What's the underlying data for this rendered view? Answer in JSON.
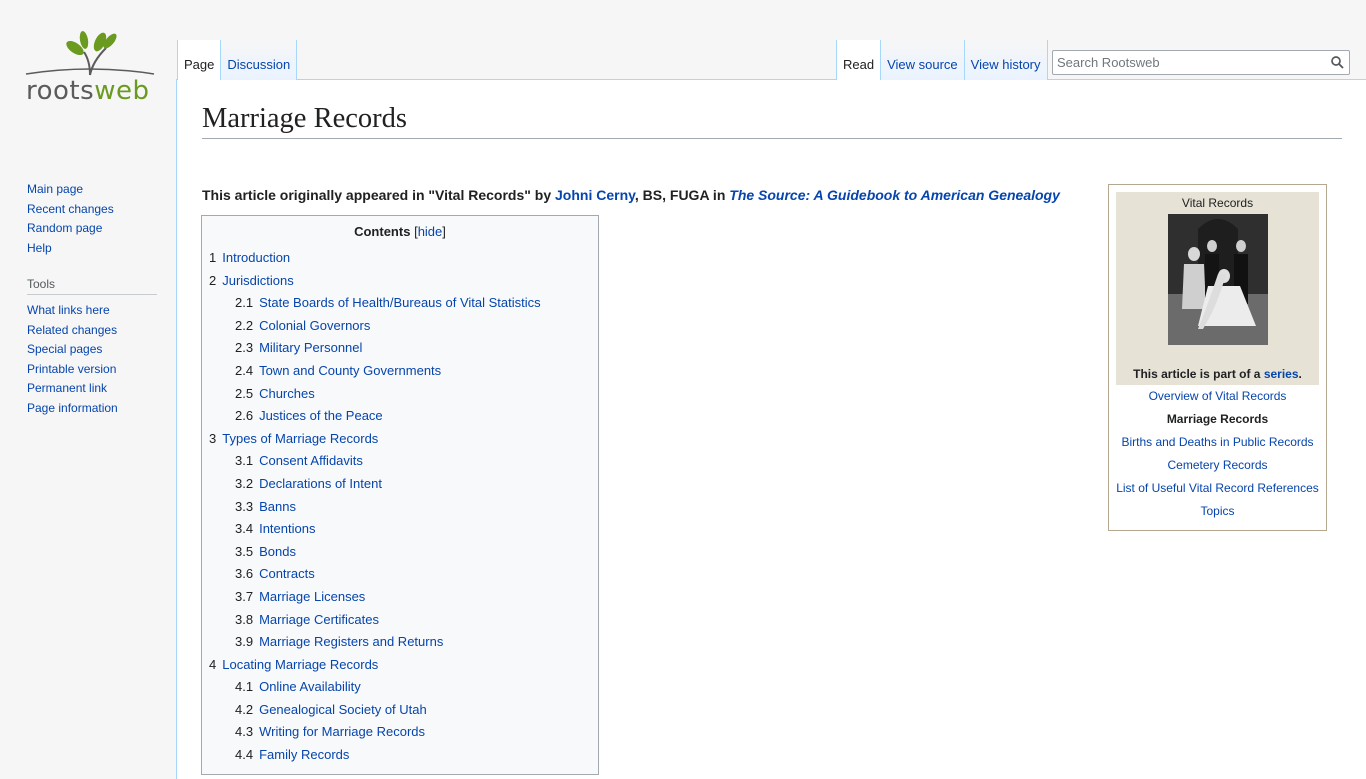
{
  "logo": {
    "text_main": "roots",
    "text_accent": "web"
  },
  "sidebar": {
    "nav": [
      "Main page",
      "Recent changes",
      "Random page",
      "Help"
    ],
    "tools_heading": "Tools",
    "tools": [
      "What links here",
      "Related changes",
      "Special pages",
      "Printable version",
      "Permanent link",
      "Page information"
    ]
  },
  "tabs": {
    "left": [
      "Page",
      "Discussion"
    ],
    "right": [
      "Read",
      "View source",
      "View history"
    ]
  },
  "search": {
    "placeholder": "Search Rootsweb"
  },
  "page": {
    "title": "Marriage Records",
    "intro": {
      "prefix": "This article originally appeared in \"Vital Records\" by ",
      "author": "Johni Cerny",
      "suffix": ", BS, FUGA in ",
      "book": "The Source: A Guidebook to American Genealogy"
    }
  },
  "toc": {
    "title": "Contents",
    "toggle_open": "[",
    "toggle": "hide",
    "toggle_close": "]",
    "items": [
      {
        "num": "1",
        "label": "Introduction",
        "level": 1
      },
      {
        "num": "2",
        "label": "Jurisdictions",
        "level": 1
      },
      {
        "num": "2.1",
        "label": "State Boards of Health/Bureaus of Vital Statistics",
        "level": 2
      },
      {
        "num": "2.2",
        "label": "Colonial Governors",
        "level": 2
      },
      {
        "num": "2.3",
        "label": "Military Personnel",
        "level": 2
      },
      {
        "num": "2.4",
        "label": "Town and County Governments",
        "level": 2
      },
      {
        "num": "2.5",
        "label": "Churches",
        "level": 2
      },
      {
        "num": "2.6",
        "label": "Justices of the Peace",
        "level": 2
      },
      {
        "num": "3",
        "label": "Types of Marriage Records",
        "level": 1
      },
      {
        "num": "3.1",
        "label": "Consent Affidavits",
        "level": 2
      },
      {
        "num": "3.2",
        "label": "Declarations of Intent",
        "level": 2
      },
      {
        "num": "3.3",
        "label": "Banns",
        "level": 2
      },
      {
        "num": "3.4",
        "label": "Intentions",
        "level": 2
      },
      {
        "num": "3.5",
        "label": "Bonds",
        "level": 2
      },
      {
        "num": "3.6",
        "label": "Contracts",
        "level": 2
      },
      {
        "num": "3.7",
        "label": "Marriage Licenses",
        "level": 2
      },
      {
        "num": "3.8",
        "label": "Marriage Certificates",
        "level": 2
      },
      {
        "num": "3.9",
        "label": "Marriage Registers and Returns",
        "level": 2
      },
      {
        "num": "4",
        "label": "Locating Marriage Records",
        "level": 1
      },
      {
        "num": "4.1",
        "label": "Online Availability",
        "level": 2
      },
      {
        "num": "4.2",
        "label": "Genealogical Society of Utah",
        "level": 2
      },
      {
        "num": "4.3",
        "label": "Writing for Marriage Records",
        "level": 2
      },
      {
        "num": "4.4",
        "label": "Family Records",
        "level": 2
      }
    ]
  },
  "infobox": {
    "title": "Vital Records",
    "series_prefix": "This article is part of a ",
    "series_link": "series",
    "series_suffix": ".",
    "links": [
      {
        "label": "Overview of Vital Records",
        "current": false
      },
      {
        "label": "Marriage Records",
        "current": true
      },
      {
        "label": "Births and Deaths in Public Records",
        "current": false
      },
      {
        "label": "Cemetery Records",
        "current": false
      },
      {
        "label": "List of Useful Vital Record References",
        "current": false
      },
      {
        "label": "Topics",
        "current": false
      }
    ]
  },
  "colors": {
    "link": "#0645ad",
    "tab_border": "#a7d7f9",
    "logo_green": "#6a9a1f"
  }
}
